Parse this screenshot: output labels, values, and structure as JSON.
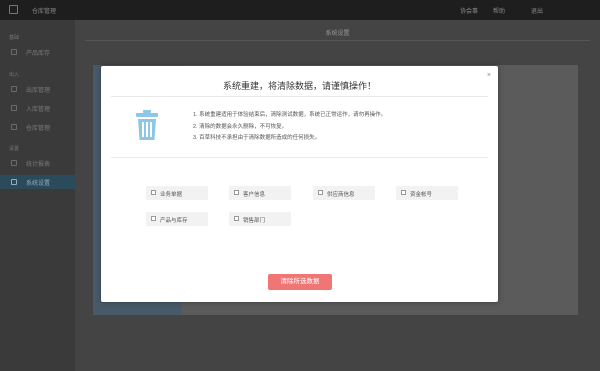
{
  "app": {
    "title": "仓库管理"
  },
  "topbar": {
    "links": [
      "协会事",
      "帮助",
      "退出"
    ]
  },
  "sidebar": {
    "groups": [
      {
        "title": "基础",
        "items": [
          "产品库存"
        ]
      },
      {
        "title": "出入",
        "items": [
          "出库管理",
          "入库管理",
          "仓库管理"
        ]
      },
      {
        "title": "设置",
        "items": [
          "统计报表",
          "系统设置"
        ]
      }
    ]
  },
  "main": {
    "page_title": "系统设置"
  },
  "modal": {
    "title": "系统重建，将清除数据，请谨慎操作！",
    "close": "×",
    "notes": [
      "1. 系统重建适用于体验结束后，清除测试数据，系统已正常运作，请勿再操作。",
      "2. 清除的数据会永久删除，不可恢复。",
      "3. 百草科技不承担由于清除数据所造成的任何损失。"
    ],
    "options": [
      "业务单据",
      "客户信息",
      "供应商信息",
      "资金帐号",
      "产品与库存",
      "销售部门"
    ],
    "clear_button": "清除所选数据"
  },
  "colors": {
    "accent": "#f07676",
    "active_nav": "#2b4a5a",
    "trash": "#8ec7e6"
  }
}
